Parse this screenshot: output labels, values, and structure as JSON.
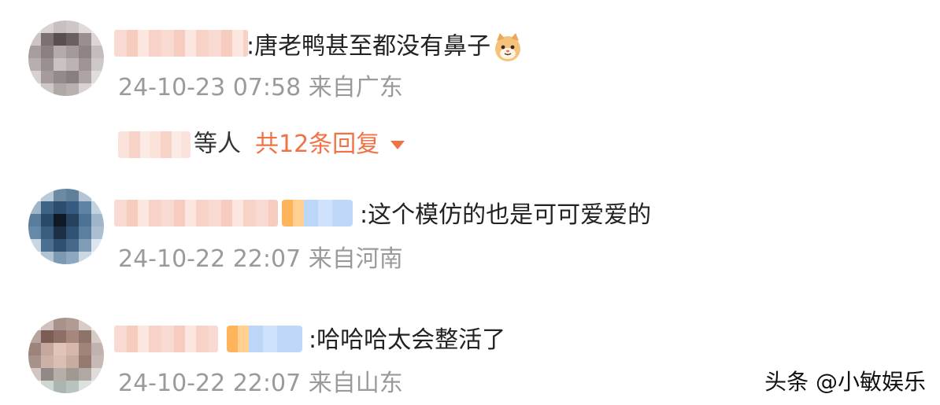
{
  "comments": [
    {
      "text": ":唐老鸭甚至都没有鼻子",
      "emoji": "cat-face-icon",
      "meta": "24-10-23 07:58 来自广东",
      "replies": {
        "suffix": "等人",
        "link": "共12条回复"
      }
    },
    {
      "text": ":这个模仿的也是可可爱爱的",
      "meta": "24-10-22 22:07 来自河南"
    },
    {
      "text": ":哈哈哈太会整活了",
      "meta": "24-10-22 22:07 来自山东"
    }
  ],
  "watermark": "头条 @小敏娱乐",
  "colors": {
    "reply_link": "#f07245",
    "meta_text": "#9a9a9a",
    "body_text": "#222222"
  }
}
